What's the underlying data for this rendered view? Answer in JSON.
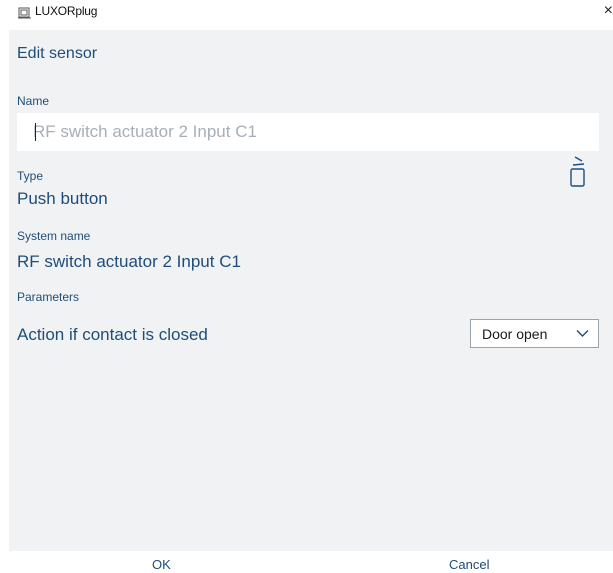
{
  "window": {
    "app_title": "LUXORplug",
    "close_glyph": "×"
  },
  "header": {
    "title": "Edit sensor"
  },
  "form": {
    "name_label": "Name",
    "name_value": "",
    "name_placeholder": "RF switch actuator 2 Input C1",
    "type_label": "Type",
    "type_value": "Push button",
    "system_name_label": "System name",
    "system_name_value": "RF switch actuator 2 Input C1",
    "parameters_label": "Parameters",
    "action_label": "Action if contact is closed",
    "action_select": {
      "selected": "Door open"
    }
  },
  "footer": {
    "ok_label": "OK",
    "cancel_label": "Cancel"
  },
  "icons": {
    "app": "app-logo-icon",
    "close": "close-icon",
    "delete": "trash-icon",
    "dropdown": "chevron-down-icon"
  },
  "colors": {
    "accent_text": "#1e4d7a",
    "panel_bg": "#f1f2f4",
    "placeholder": "#a7afb8"
  }
}
